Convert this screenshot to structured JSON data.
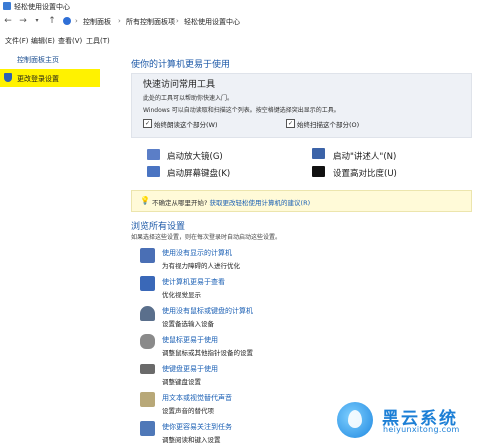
{
  "window": {
    "title": "轻松使用设置中心"
  },
  "address": {
    "crumbs": [
      "控制面板",
      "所有控制面板项",
      "轻松使用设置中心"
    ],
    "sep": "›"
  },
  "menu": [
    "文件(F)",
    "编辑(E)",
    "查看(V)",
    "工具(T)"
  ],
  "sidebar": {
    "home": "控制面板主页",
    "active": "更改登录设置"
  },
  "main": {
    "heading": "使你的计算机更易于使用",
    "quick_access": {
      "title": "快速访问常用工具",
      "text1": "此处的工具可以帮助你快速入门。",
      "text2": "Windows 可以自动读取和扫描这个列表。按空格键选择突出显示的工具。",
      "check1": "始终朗读这个部分(W)",
      "check2": "始终扫描这个部分(O)",
      "check1_mark": "✓",
      "check2_mark": "✓"
    },
    "tools": [
      {
        "label": "启动放大镜(G)",
        "icon": "magnifier-icon",
        "color": "#5b7ec7"
      },
      {
        "label": "启动\"讲述人\"(N)",
        "icon": "narrator-icon",
        "color": "#3c63a8"
      },
      {
        "label": "启动屏幕键盘(K)",
        "icon": "keyboard-icon",
        "color": "#4a74c2"
      },
      {
        "label": "设置高对比度(U)",
        "icon": "contrast-icon",
        "color": "#111111"
      }
    ],
    "hint": {
      "icon": "💡",
      "prefix": "不确定从哪里开始? ",
      "link": "获取更改轻松使用计算机的建议(R)"
    },
    "browse": {
      "heading": "浏览所有设置",
      "subtext": "如果选择这些设置，则在每次登录时自动启动这些设置。",
      "items": [
        {
          "link": "使用没有显示的计算机",
          "desc": "为有视力障碍的人进行优化",
          "icon": "monitor-icon",
          "color": "#4a6fb5"
        },
        {
          "link": "使计算机更易于查看",
          "desc": "优化视觉显示",
          "icon": "display-icon",
          "color": "#3a68b8"
        },
        {
          "link": "使用没有鼠标或键盘的计算机",
          "desc": "设置备选输入设备",
          "icon": "user-icon",
          "color": "#5a6f8c"
        },
        {
          "link": "使鼠标更易于使用",
          "desc": "调整鼠标或其他指针设备的设置",
          "icon": "mouse-icon",
          "color": "#8a8a8a"
        },
        {
          "link": "使键盘更易于使用",
          "desc": "调整键盘设置",
          "icon": "keyboard-icon",
          "color": "#6a6a6a"
        },
        {
          "link": "用文本或视觉替代声音",
          "desc": "设置声音的替代项",
          "icon": "speaker-icon",
          "color": "#b8a878"
        },
        {
          "link": "使你更容易关注到任务",
          "desc": "调整阅读和键入设置",
          "icon": "focus-icon",
          "color": "#4f78b8"
        }
      ]
    }
  },
  "watermark": {
    "brand": "黑云系统",
    "url": "heiyunxitong.com"
  }
}
